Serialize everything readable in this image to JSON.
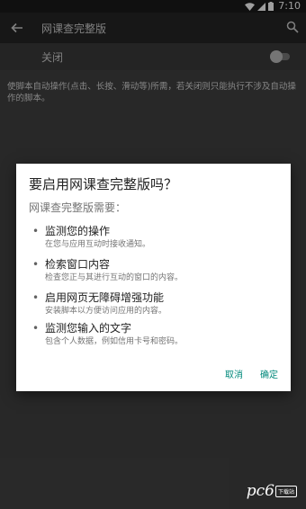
{
  "status_bar": {
    "time": "7:10"
  },
  "toolbar": {
    "title": "网课查完整版",
    "back_icon": "arrow-left-icon",
    "search_icon": "search-icon"
  },
  "switch_row": {
    "label": "关闭",
    "enabled": false
  },
  "description": "使脚本自动操作(点击、长按、滑动等)所需，若关闭则只能执行不涉及自动操作的脚本。",
  "dialog": {
    "title": "要启用网课查完整版吗？",
    "subtitle": "网课查完整版需要：",
    "permissions": [
      {
        "title": "监测您的操作",
        "description": "在您与应用互动时接收通知。"
      },
      {
        "title": "检索窗口内容",
        "description": "检查您正与其进行互动的窗口的内容。"
      },
      {
        "title": "启用网页无障碍增强功能",
        "description": "安装脚本以方便访问应用的内容。"
      },
      {
        "title": "监测您输入的文字",
        "description": "包含个人数据，例如信用卡号和密码。"
      }
    ],
    "cancel_label": "取消",
    "ok_label": "确定",
    "accent_color": "#00897b"
  },
  "watermark": {
    "text": "pc6",
    "badge": "下载站"
  }
}
